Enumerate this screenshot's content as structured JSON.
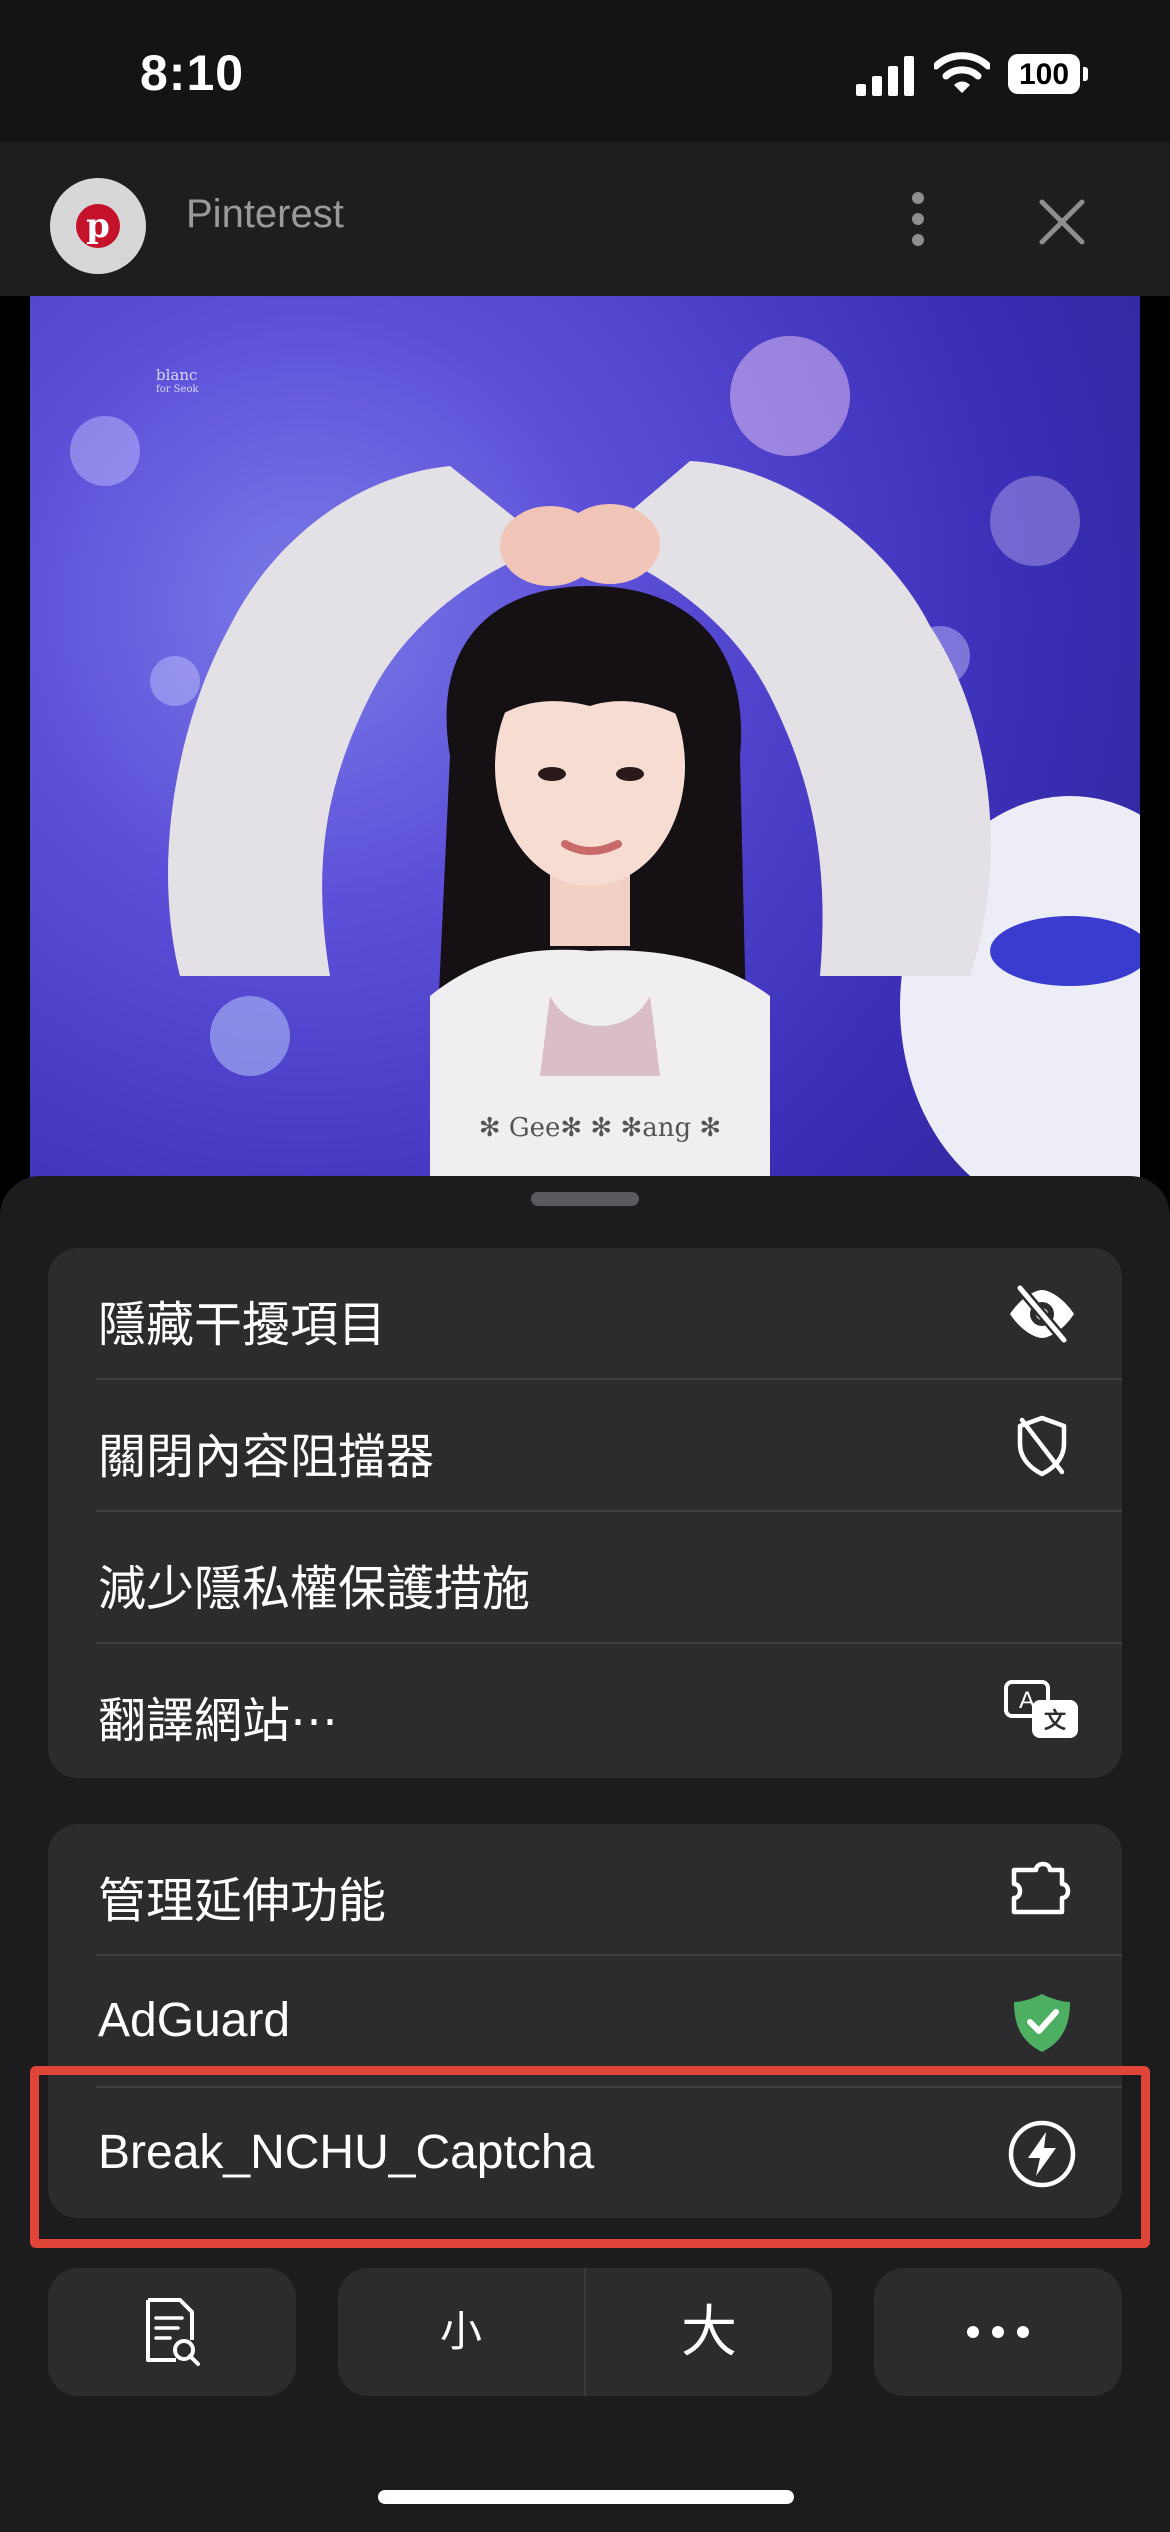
{
  "status_bar": {
    "time": "8:10",
    "battery": "100",
    "icons": [
      "cellular-signal-icon",
      "wifi-icon",
      "battery-icon"
    ]
  },
  "header": {
    "site_title": "Pinterest",
    "logo_letter": "p",
    "logo_icon": "pinterest-logo-icon",
    "menu_icon": "vertical-ellipsis-icon",
    "close_icon": "close-icon"
  },
  "photo": {
    "watermark_line1": "blanc",
    "watermark_line2": "for Seok",
    "shirt_text": "✻ Gee✻ ✻ ✻ang ✻"
  },
  "menu_group_1": [
    {
      "label": "隱藏干擾項目",
      "icon": "eye-slash-icon"
    },
    {
      "label": "關閉內容阻擋器",
      "icon": "shield-slash-icon"
    },
    {
      "label": "減少隱私權保護措施",
      "icon": ""
    },
    {
      "label": "翻譯網站⋯",
      "icon": "translate-icon"
    }
  ],
  "menu_group_2": [
    {
      "label": "管理延伸功能",
      "icon": "puzzle-extension-icon"
    },
    {
      "label": "AdGuard",
      "icon": "adguard-shield-icon"
    },
    {
      "label": "Break_NCHU_Captcha",
      "icon": "lightning-bolt-icon"
    }
  ],
  "bottom_bar": {
    "reader_icon": "reader-search-icon",
    "small_text": "小",
    "large_text": "大",
    "more_icon": "horizontal-ellipsis-icon"
  },
  "colors": {
    "highlight_border": "#e0453a",
    "sheet_background": "#1c1c1e",
    "group_background": "#2c2c2e",
    "adguard_green": "#4caf62",
    "pinterest_red": "#c4122a"
  }
}
